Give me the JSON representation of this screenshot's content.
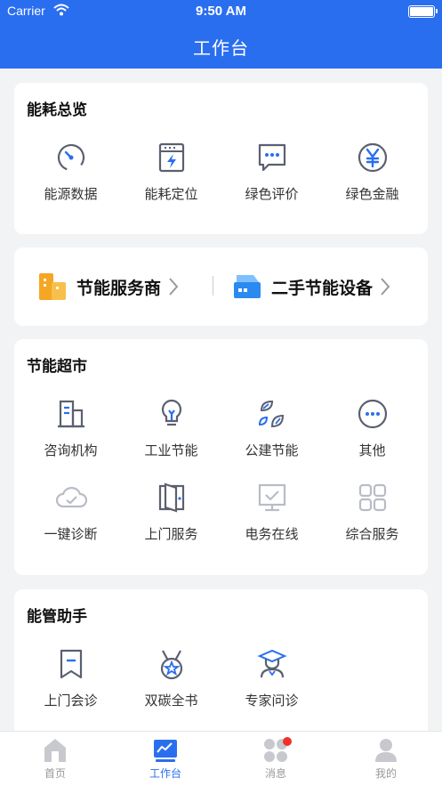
{
  "status_bar": {
    "carrier": "Carrier",
    "time": "9:50 AM"
  },
  "header": {
    "title": "工作台"
  },
  "energy_overview": {
    "title": "能耗总览",
    "items": [
      {
        "label": "能源数据",
        "icon": "gauge-icon"
      },
      {
        "label": "能耗定位",
        "icon": "power-panel-icon"
      },
      {
        "label": "绿色评价",
        "icon": "chat-bubble-icon"
      },
      {
        "label": "绿色金融",
        "icon": "yen-coin-icon"
      }
    ]
  },
  "services": {
    "provider_label": "节能服务商",
    "equipment_label": "二手节能设备"
  },
  "market": {
    "title": "节能超市",
    "items": [
      {
        "label": "咨询机构",
        "icon": "building-icon"
      },
      {
        "label": "工业节能",
        "icon": "bulb-icon"
      },
      {
        "label": "公建节能",
        "icon": "leaves-icon"
      },
      {
        "label": "其他",
        "icon": "more-circle-icon"
      },
      {
        "label": "一键诊断",
        "icon": "cloud-check-icon"
      },
      {
        "label": "上门服务",
        "icon": "door-icon"
      },
      {
        "label": "电务在线",
        "icon": "monitor-check-icon"
      },
      {
        "label": "综合服务",
        "icon": "grid-icon"
      }
    ]
  },
  "assistant": {
    "title": "能管助手",
    "items": [
      {
        "label": "上门会诊",
        "icon": "bookmark-icon"
      },
      {
        "label": "双碳全书",
        "icon": "medal-icon"
      },
      {
        "label": "专家问诊",
        "icon": "expert-icon"
      }
    ]
  },
  "tabbar": {
    "tabs": [
      {
        "label": "首页"
      },
      {
        "label": "工作台"
      },
      {
        "label": "消息"
      },
      {
        "label": "我的"
      }
    ]
  },
  "colors": {
    "primary": "#2a6ef0",
    "icon_gray": "#5b6070",
    "accent_orange": "#f5a623",
    "badge_red": "#f0302a"
  }
}
